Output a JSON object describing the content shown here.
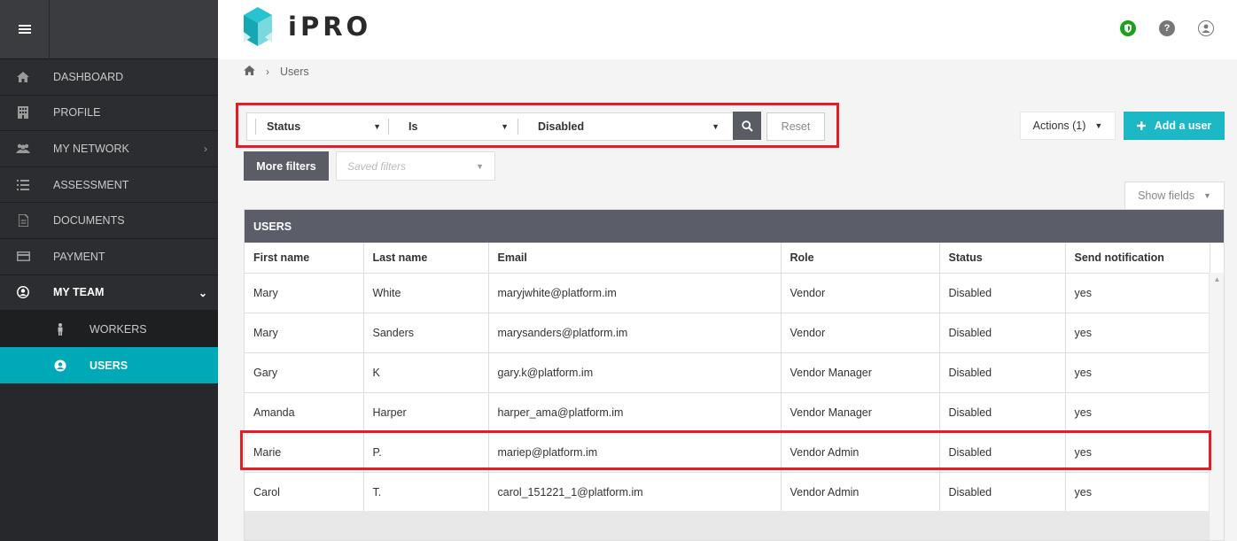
{
  "app": {
    "logo_text": "iPRO",
    "brand_colors": {
      "teal": "#1cb8c6",
      "sidebar": "#26282b",
      "highlight_red": "#e01f27"
    }
  },
  "header": {
    "icons": [
      "shield-badge-icon",
      "help-icon",
      "user-account-icon"
    ]
  },
  "sidebar": {
    "items": [
      {
        "label": "DASHBOARD",
        "icon": "home-icon"
      },
      {
        "label": "PROFILE",
        "icon": "building-icon"
      },
      {
        "label": "MY NETWORK",
        "icon": "users-group-icon"
      },
      {
        "label": "ASSESSMENT",
        "icon": "list-icon"
      },
      {
        "label": "DOCUMENTS",
        "icon": "document-icon"
      },
      {
        "label": "PAYMENT",
        "icon": "credit-card-icon"
      },
      {
        "label": "MY TEAM",
        "icon": "user-circle-icon"
      }
    ],
    "sub_items": [
      {
        "label": "WORKERS",
        "icon": "person-icon"
      },
      {
        "label": "USERS",
        "icon": "user-circle-icon"
      }
    ]
  },
  "breadcrumb": {
    "current": "Users"
  },
  "filters": {
    "field": "Status",
    "operator": "Is",
    "value": "Disabled",
    "reset_label": "Reset",
    "more_filters_label": "More filters",
    "saved_filters_placeholder": "Saved filters"
  },
  "toolbar": {
    "actions_label": "Actions (1)",
    "add_user_label": "Add a user",
    "show_fields_label": "Show fields"
  },
  "table": {
    "title": "USERS",
    "columns": [
      "First name",
      "Last name",
      "Email",
      "Role",
      "Status",
      "Send notification"
    ],
    "rows": [
      [
        "Mary",
        "White",
        "maryjwhite@platform.im",
        "Vendor",
        "Disabled",
        "yes"
      ],
      [
        "Mary",
        "Sanders",
        "marysanders@platform.im",
        "Vendor",
        "Disabled",
        "yes"
      ],
      [
        "Gary",
        "K",
        "gary.k@platform.im",
        "Vendor Manager",
        "Disabled",
        "yes"
      ],
      [
        "Amanda",
        "Harper",
        "harper_ama@platform.im",
        "Vendor Manager",
        "Disabled",
        "yes"
      ],
      [
        "Marie",
        "P.",
        "mariep@platform.im",
        "Vendor Admin",
        "Disabled",
        "yes"
      ],
      [
        "Carol",
        "T.",
        "carol_151221_1@platform.im",
        "Vendor Admin",
        "Disabled",
        "yes"
      ]
    ]
  }
}
